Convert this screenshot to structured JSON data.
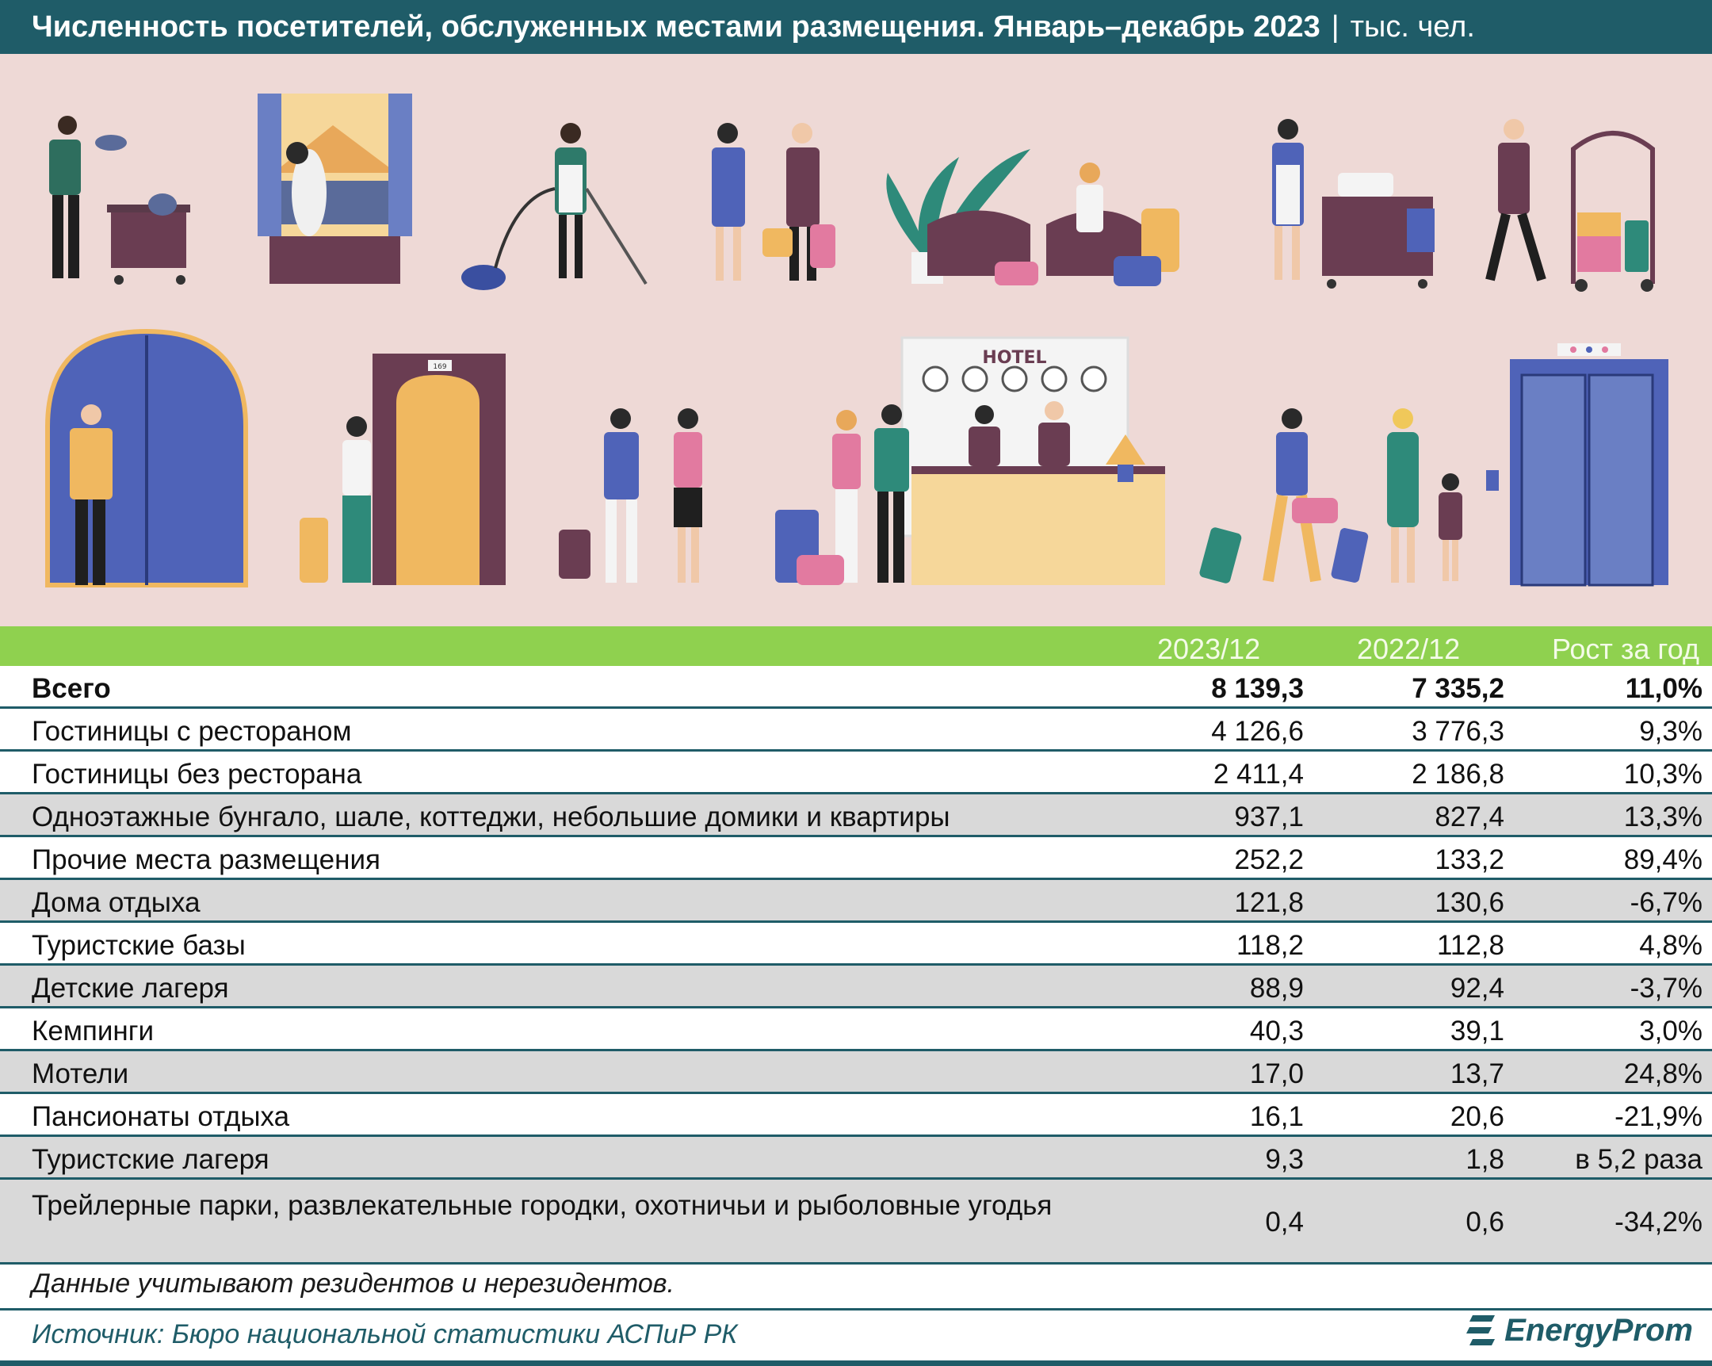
{
  "header": {
    "title": "Численность посетителей, обслуженных местами размещения. Январь–декабрь 2023",
    "separator": "|",
    "unit": "тыс. чел."
  },
  "illustration": {
    "hotel_sign": "HOTEL",
    "room_number": "169"
  },
  "chart_data": {
    "type": "table",
    "columns": [
      "2023/12",
      "2022/12",
      "Рост за год"
    ],
    "rows": [
      {
        "label": "Всего",
        "v2023": "8 139,3",
        "v2022": "7 335,2",
        "growth": "11,0%"
      },
      {
        "label": "Гостиницы с рестораном",
        "v2023": "4 126,6",
        "v2022": "3 776,3",
        "growth": "9,3%"
      },
      {
        "label": "Гостиницы без ресторана",
        "v2023": "2 411,4",
        "v2022": "2 186,8",
        "growth": "10,3%"
      },
      {
        "label": "Одноэтажные бунгало, шале, коттеджи, небольшие домики и квартиры",
        "v2023": "937,1",
        "v2022": "827,4",
        "growth": "13,3%"
      },
      {
        "label": "Прочие места размещения",
        "v2023": "252,2",
        "v2022": "133,2",
        "growth": "89,4%"
      },
      {
        "label": "Дома отдыха",
        "v2023": "121,8",
        "v2022": "130,6",
        "growth": "-6,7%"
      },
      {
        "label": "Туристские базы",
        "v2023": "118,2",
        "v2022": "112,8",
        "growth": "4,8%"
      },
      {
        "label": "Детские лагеря",
        "v2023": "88,9",
        "v2022": "92,4",
        "growth": "-3,7%"
      },
      {
        "label": "Кемпинги",
        "v2023": "40,3",
        "v2022": "39,1",
        "growth": "3,0%"
      },
      {
        "label": "Мотели",
        "v2023": "17,0",
        "v2022": "13,7",
        "growth": "24,8%"
      },
      {
        "label": "Пансионаты отдыха",
        "v2023": "16,1",
        "v2022": "20,6",
        "growth": "-21,9%"
      },
      {
        "label": "Туристские лагеря",
        "v2023": "9,3",
        "v2022": "1,8",
        "growth": "в 5,2 раза"
      },
      {
        "label": "Трейлерные парки, развлекательные городки, охотничьи и рыболовные угодья",
        "v2023": "0,4",
        "v2022": "0,6",
        "growth": "-34,2%"
      }
    ]
  },
  "footer": {
    "note": "Данные учитывают резидентов и нерезидентов.",
    "source": "Источник: Бюро национальной статистики АСПиР РК",
    "logo_text": "EnergyProm"
  },
  "colors": {
    "header_bg": "#1f5c68",
    "table_header_bg": "#8fd14f",
    "illustration_bg": "#eed9d6",
    "alt_row": "#d9d9d9"
  }
}
